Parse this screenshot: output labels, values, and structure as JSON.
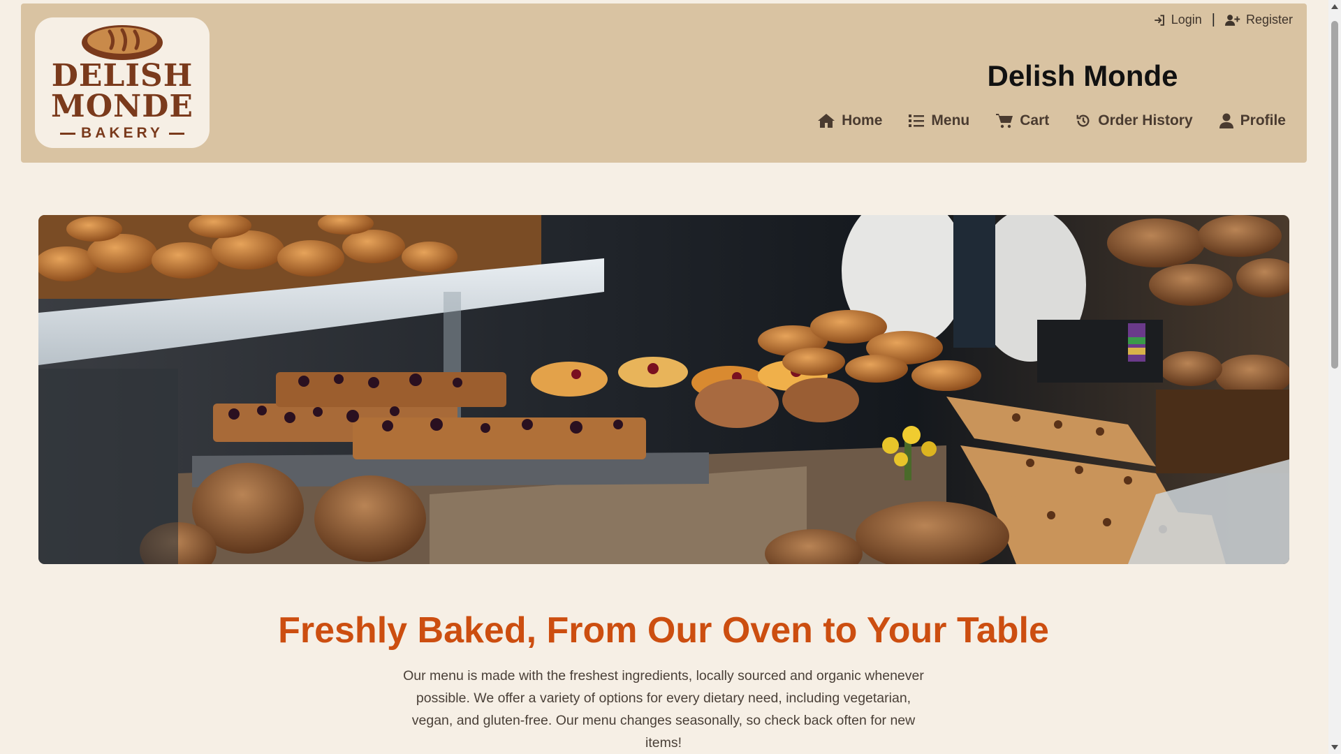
{
  "header": {
    "logo": {
      "line1": "DELISH",
      "line2": "MONDE",
      "line3": "BAKERY"
    },
    "auth": {
      "login_label": "Login",
      "separator": "|",
      "register_label": "Register"
    },
    "site_title": "Delish Monde",
    "nav": {
      "home": "Home",
      "menu": "Menu",
      "cart": "Cart",
      "order_history": "Order History",
      "profile": "Profile"
    }
  },
  "main": {
    "headline": "Freshly Baked, From Our Oven to Your Table",
    "intro": "Our menu is made with the freshest ingredients, locally sourced and organic whenever possible. We offer a variety of options for every dietary need, including vegetarian, vegan, and gluten-free. Our menu changes seasonally, so check back often for new items!"
  },
  "icons": {
    "login": "login-icon",
    "register": "user-plus-icon",
    "home": "home-icon",
    "menu": "list-icon",
    "cart": "cart-icon",
    "order_history": "history-icon",
    "profile": "user-icon"
  },
  "colors": {
    "header_bg": "#d9c3a2",
    "page_bg": "#f6efe5",
    "accent": "#cc4e10",
    "logo_brown": "#7a3a1c"
  }
}
